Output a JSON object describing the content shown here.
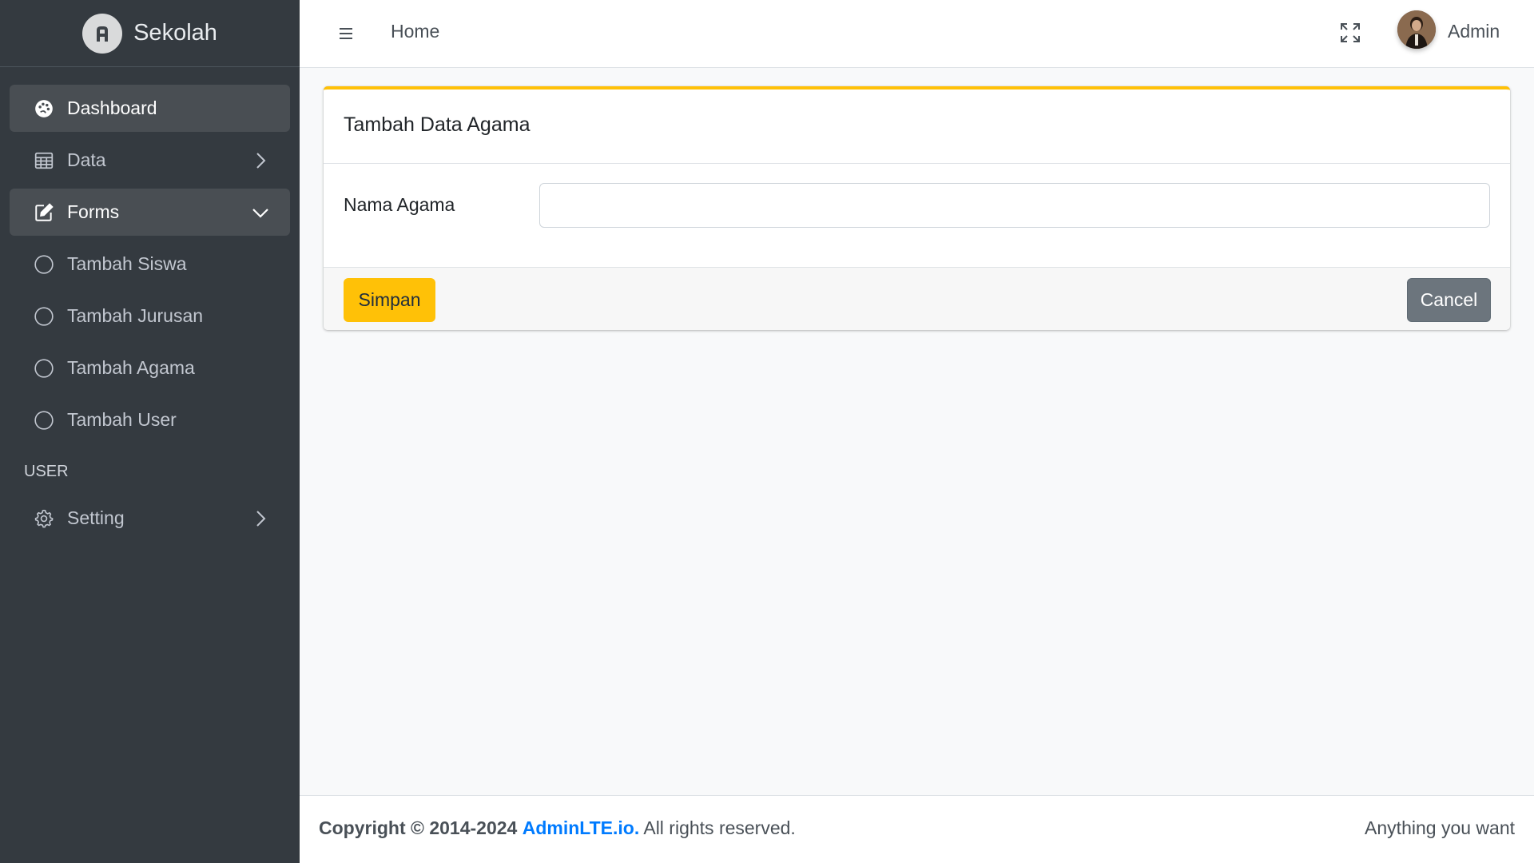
{
  "brand": {
    "name": "Sekolah",
    "logo_icon": "adminlte-logo"
  },
  "sidebar": {
    "items": [
      {
        "label": "Dashboard",
        "icon": "palette-icon",
        "active": true
      },
      {
        "label": "Data",
        "icon": "table-icon",
        "arrow": "chevron-right"
      },
      {
        "label": "Forms",
        "icon": "pencil-square-icon",
        "active": true,
        "arrow": "chevron-down"
      }
    ],
    "sub_items": [
      {
        "label": "Tambah Siswa",
        "icon": "circle-icon"
      },
      {
        "label": "Tambah Jurusan",
        "icon": "circle-icon"
      },
      {
        "label": "Tambah Agama",
        "icon": "circle-icon"
      },
      {
        "label": "Tambah User",
        "icon": "circle-icon"
      }
    ],
    "header_user": "USER",
    "setting": {
      "label": "Setting",
      "icon": "gear-icon",
      "arrow": "chevron-right"
    }
  },
  "topbar": {
    "home": "Home",
    "user_name": "Admin"
  },
  "card": {
    "title": "Tambah Data Agama",
    "field_label": "Nama Agama",
    "field_value": "",
    "save_label": "Simpan",
    "cancel_label": "Cancel",
    "accent_color": "#ffc107"
  },
  "footer": {
    "copyright_prefix": "Copyright © 2014-2024",
    "link_text": "AdminLTE.io.",
    "suffix": "All rights reserved.",
    "right_text": "Anything you want"
  }
}
